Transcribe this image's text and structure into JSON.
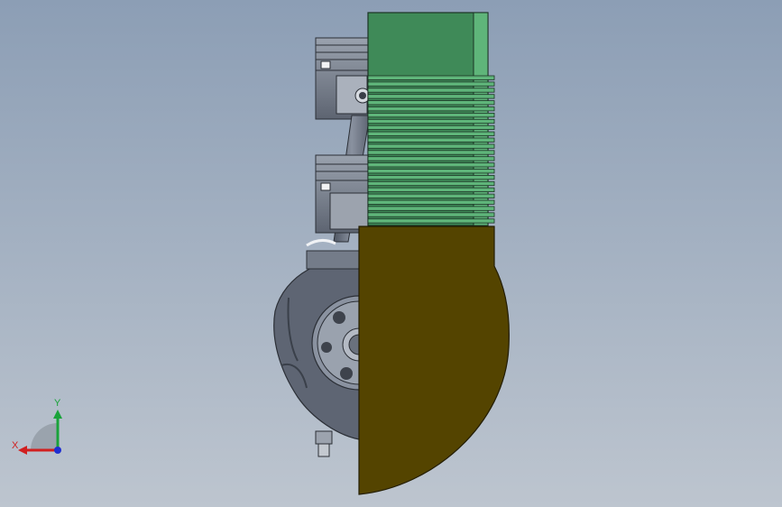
{
  "viewport": {
    "background_top": "#8c9eb5",
    "background_bottom": "#bdc5cf"
  },
  "model": {
    "cylinder_block_color": "#3f8a58",
    "cylinder_fin_color": "#5fb57a",
    "crankcase_cover_color": "#544400",
    "engine_body_color": "#6f7785"
  },
  "triad": {
    "x_label": "X",
    "y_label": "Y",
    "x_color": "#d11f1f",
    "y_color": "#1aa33a",
    "z_color": "#1f2fd1"
  }
}
